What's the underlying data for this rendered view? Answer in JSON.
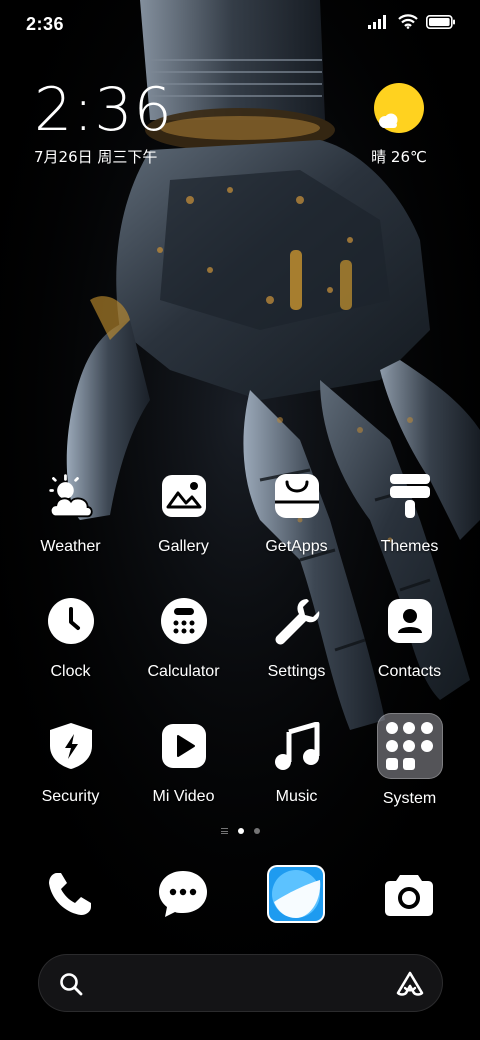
{
  "status_bar": {
    "time": "2:36",
    "signal_icon": "signal-bars-icon",
    "wifi_icon": "wifi-icon",
    "battery_icon": "battery-icon"
  },
  "clock_widget": {
    "time": "2:36",
    "date": "7月26日 周三下午"
  },
  "weather_widget": {
    "icon": "sun-with-cloud-icon",
    "text": "晴 26℃"
  },
  "apps": [
    {
      "label": "Weather",
      "icon": "weather-icon"
    },
    {
      "label": "Gallery",
      "icon": "gallery-icon"
    },
    {
      "label": "GetApps",
      "icon": "getapps-bag-icon"
    },
    {
      "label": "Themes",
      "icon": "themes-brush-icon"
    },
    {
      "label": "Clock",
      "icon": "clock-icon"
    },
    {
      "label": "Calculator",
      "icon": "calculator-icon"
    },
    {
      "label": "Settings",
      "icon": "wrench-icon"
    },
    {
      "label": "Contacts",
      "icon": "contacts-icon"
    },
    {
      "label": "Security",
      "icon": "shield-bolt-icon"
    },
    {
      "label": "Mi Video",
      "icon": "play-icon"
    },
    {
      "label": "Music",
      "icon": "music-note-icon"
    },
    {
      "label": "System",
      "icon": "folder-icon"
    }
  ],
  "page_indicator": {
    "pages": 2,
    "current": 1
  },
  "dock": [
    {
      "name": "Phone",
      "icon": "phone-icon"
    },
    {
      "name": "Messages",
      "icon": "message-bubble-icon"
    },
    {
      "name": "Browser",
      "icon": "browser-icon"
    },
    {
      "name": "Camera",
      "icon": "camera-icon"
    }
  ],
  "search_bar": {
    "placeholder": "",
    "search_icon": "search-icon",
    "assistant_icon": "assistant-icon"
  },
  "colors": {
    "background": "#000000",
    "sun": "#FFD21F",
    "browser_accent": "#1E9BF0",
    "metal_accent": "#B8873A"
  }
}
